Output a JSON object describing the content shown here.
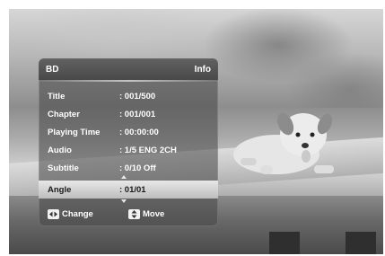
{
  "osd": {
    "title": "BD",
    "info_label": "Info",
    "rows": [
      {
        "label": "Title",
        "value": ": 001/500"
      },
      {
        "label": "Chapter",
        "value": ": 001/001"
      },
      {
        "label": "Playing Time",
        "value": ": 00:00:00"
      },
      {
        "label": "Audio",
        "value": ": 1/5 ENG 2CH"
      },
      {
        "label": "Subtitle",
        "value": ": 0/10 Off"
      },
      {
        "label": "Angle",
        "value": ": 01/01"
      }
    ],
    "selected_row": "Angle",
    "footer": {
      "change_label": "Change",
      "move_label": "Move",
      "change_icon": "left-right-arrows-icon",
      "move_icon": "up-down-arrows-icon"
    }
  },
  "colors": {
    "panel": "#464646",
    "selected_row": "#d0d0d0",
    "text": "#ffffff"
  }
}
